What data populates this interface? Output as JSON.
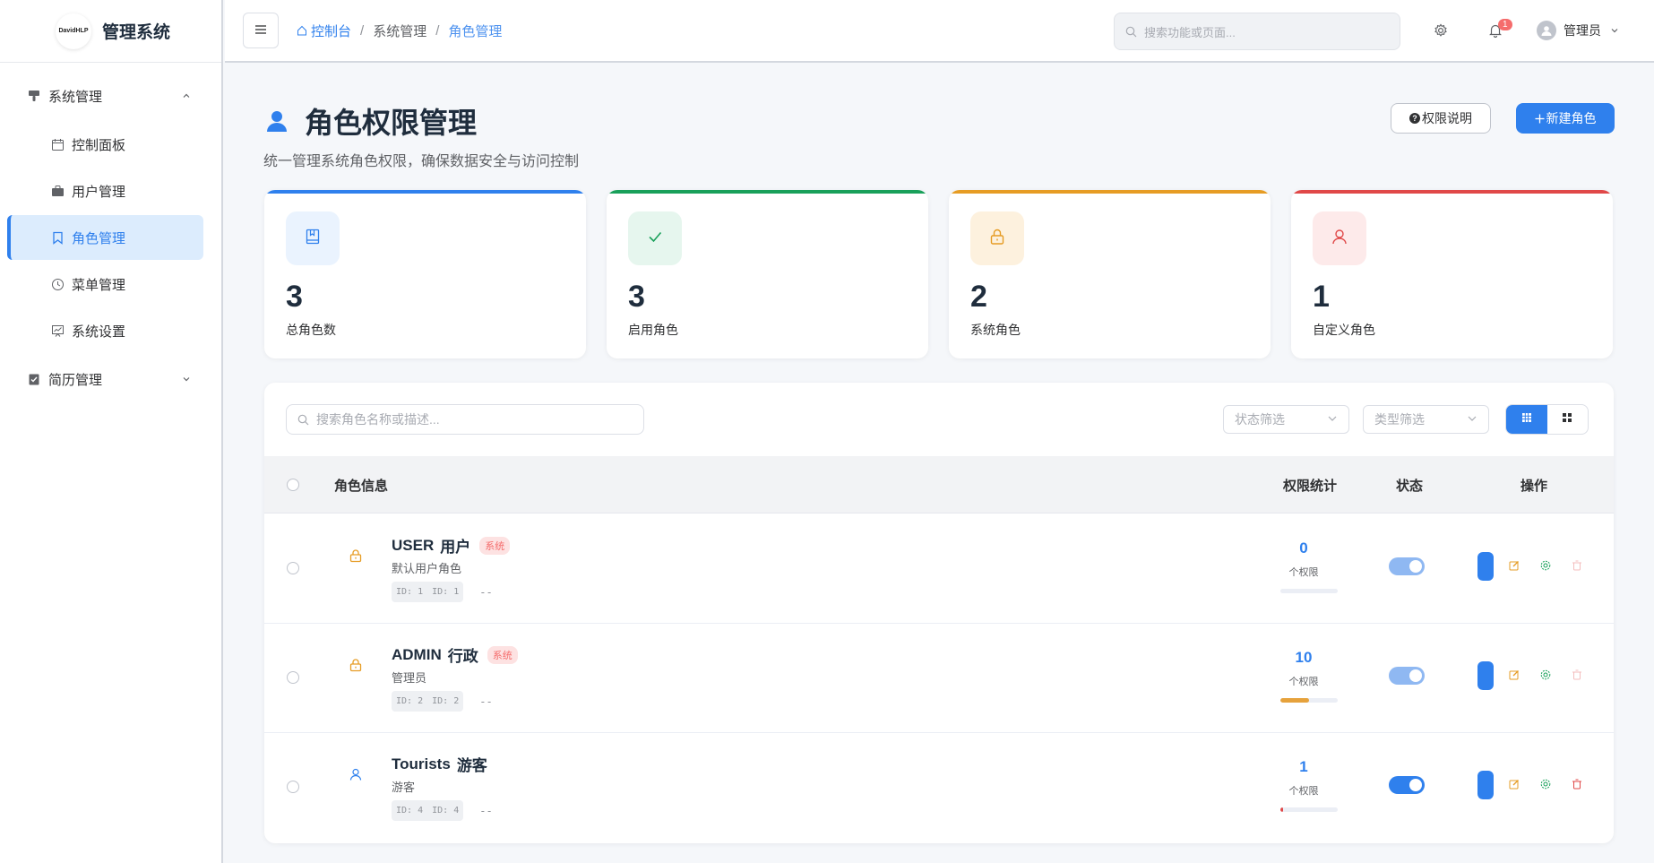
{
  "sidebar": {
    "logo_text": "DavidHLP",
    "title": "管理系统",
    "group1": "系统管理",
    "items": [
      {
        "label": "控制面板"
      },
      {
        "label": "用户管理"
      },
      {
        "label": "角色管理"
      },
      {
        "label": "菜单管理"
      },
      {
        "label": "系统设置"
      }
    ],
    "group2": "简历管理"
  },
  "header": {
    "breadcrumb": [
      "控制台",
      "系统管理",
      "角色管理"
    ],
    "search_placeholder": "搜索功能或页面...",
    "notification_count": "1",
    "user_name": "管理员"
  },
  "page": {
    "title": "角色权限管理",
    "subtitle": "统一管理系统角色权限，确保数据安全与访问控制",
    "help_button": "权限说明",
    "new_button": "新建角色"
  },
  "stats": [
    {
      "value": "3",
      "label": "总角色数",
      "color": "#2f80ed"
    },
    {
      "value": "3",
      "label": "启用角色",
      "color": "#19a05a"
    },
    {
      "value": "2",
      "label": "系统角色",
      "color": "#e69c24"
    },
    {
      "value": "1",
      "label": "自定义角色",
      "color": "#e04848"
    }
  ],
  "table": {
    "search_placeholder": "搜索角色名称或描述...",
    "status_filter": "状态筛选",
    "type_filter": "类型筛选",
    "columns": {
      "info": "角色信息",
      "perms": "权限统计",
      "status": "状态",
      "actions": "操作"
    },
    "rows": [
      {
        "code": "USER",
        "name": "用户",
        "tag": "系统",
        "desc": "默认用户角色",
        "id1": "ID: 1",
        "id2": "ID: 1",
        "extra": "--",
        "perm_count": "0",
        "perm_unit": "个权限",
        "perm_fraction": 0.0,
        "enabled": true
      },
      {
        "code": "ADMIN",
        "name": "行政",
        "tag": "系统",
        "desc": "管理员",
        "id1": "ID: 2",
        "id2": "ID: 2",
        "extra": "--",
        "perm_count": "10",
        "perm_unit": "个权限",
        "perm_fraction": 0.5,
        "enabled": true
      },
      {
        "code": "Tourists",
        "name": "游客",
        "tag": "",
        "desc": "游客",
        "id1": "ID: 4",
        "id2": "ID: 4",
        "extra": "--",
        "perm_count": "1",
        "perm_unit": "个权限",
        "perm_fraction": 0.05,
        "enabled": true
      }
    ]
  }
}
